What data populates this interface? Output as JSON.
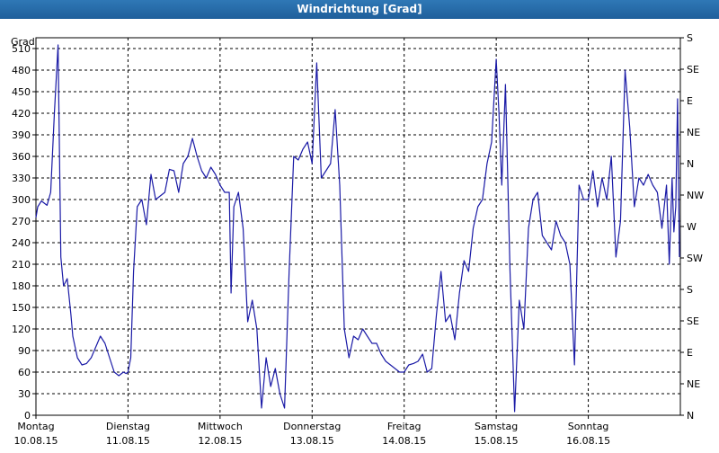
{
  "window": {
    "title": "Windrichtung [Grad]"
  },
  "chart_data": {
    "type": "line",
    "title": "Windrichtung [Grad]",
    "ylabel": "Grad",
    "ylim": [
      0,
      525
    ],
    "y_ticks": [
      0,
      30,
      60,
      90,
      120,
      150,
      180,
      210,
      240,
      270,
      300,
      330,
      360,
      390,
      420,
      450,
      480,
      510
    ],
    "y2_ticks": [
      {
        "value": 0,
        "label": "N"
      },
      {
        "value": 45,
        "label": "NE"
      },
      {
        "value": 90,
        "label": "E"
      },
      {
        "value": 135,
        "label": "SE"
      },
      {
        "value": 180,
        "label": "S"
      },
      {
        "value": 225,
        "label": "SW"
      },
      {
        "value": 270,
        "label": "W"
      },
      {
        "value": 315,
        "label": "NW"
      },
      {
        "value": 360,
        "label": "N"
      },
      {
        "value": 405,
        "label": "NE"
      },
      {
        "value": 450,
        "label": "E"
      },
      {
        "value": 495,
        "label": "SE"
      },
      {
        "value": 540,
        "label": "S"
      }
    ],
    "xlim": [
      0,
      7
    ],
    "x_days": [
      {
        "day": "Montag",
        "date": "10.08.15"
      },
      {
        "day": "Dienstag",
        "date": "11.08.15"
      },
      {
        "day": "Mittwoch",
        "date": "12.08.15"
      },
      {
        "day": "Donnerstag",
        "date": "13.08.15"
      },
      {
        "day": "Freitag",
        "date": "14.08.15"
      },
      {
        "day": "Samstag",
        "date": "15.08.15"
      },
      {
        "day": "Sonntag",
        "date": "16.08.15"
      }
    ],
    "grid": true,
    "series_color": "#1a1aa6",
    "series": [
      {
        "x": [
          0,
          0.02,
          0.06,
          0.12,
          0.16,
          0.2,
          0.24,
          0.27,
          0.3,
          0.34,
          0.38,
          0.4,
          0.45,
          0.5,
          0.55,
          0.6,
          0.65,
          0.7,
          0.75,
          0.8,
          0.85,
          0.9,
          0.95,
          0.98,
          1.0,
          1.03,
          1.06,
          1.1,
          1.15,
          1.2,
          1.25,
          1.3,
          1.35,
          1.4,
          1.45,
          1.5,
          1.55,
          1.6,
          1.65,
          1.7,
          1.75,
          1.8,
          1.85,
          1.9,
          1.95,
          2.0,
          2.05,
          2.1,
          2.12,
          2.15,
          2.2,
          2.25,
          2.3,
          2.35,
          2.4,
          2.45,
          2.5,
          2.55,
          2.6,
          2.65,
          2.7,
          2.75,
          2.8,
          2.85,
          2.9,
          2.95,
          3.0,
          3.05,
          3.1,
          3.15,
          3.2,
          3.25,
          3.3,
          3.35,
          3.4,
          3.45,
          3.5,
          3.55,
          3.6,
          3.65,
          3.7,
          3.75,
          3.8,
          3.85,
          3.9,
          3.95,
          4.0,
          4.05,
          4.1,
          4.15,
          4.2,
          4.25,
          4.3,
          4.35,
          4.4,
          4.45,
          4.5,
          4.55,
          4.6,
          4.65,
          4.7,
          4.75,
          4.8,
          4.85,
          4.9,
          4.95,
          5.0,
          5.03,
          5.06,
          5.1,
          5.15,
          5.2,
          5.25,
          5.3,
          5.35,
          5.4,
          5.45,
          5.5,
          5.55,
          5.6,
          5.65,
          5.7,
          5.75,
          5.8,
          5.85,
          5.9,
          5.95,
          6.0,
          6.05,
          6.1,
          6.15,
          6.2,
          6.25,
          6.3,
          6.35,
          6.4,
          6.45,
          6.5,
          6.55,
          6.6,
          6.65,
          6.7,
          6.75,
          6.8,
          6.85,
          6.88,
          6.91,
          6.93,
          6.95,
          6.97,
          6.99
        ],
        "y": [
          275,
          290,
          298,
          292,
          310,
          420,
          515,
          220,
          180,
          190,
          140,
          110,
          80,
          70,
          72,
          80,
          95,
          110,
          100,
          80,
          60,
          55,
          60,
          58,
          60,
          80,
          200,
          290,
          300,
          265,
          335,
          300,
          305,
          310,
          342,
          340,
          310,
          350,
          360,
          385,
          360,
          340,
          330,
          345,
          335,
          320,
          310,
          310,
          170,
          290,
          310,
          260,
          130,
          160,
          120,
          10,
          80,
          40,
          65,
          30,
          10,
          200,
          360,
          355,
          370,
          380,
          350,
          490,
          330,
          340,
          350,
          425,
          320,
          120,
          80,
          110,
          105,
          120,
          110,
          100,
          100,
          85,
          75,
          70,
          65,
          60,
          60,
          70,
          72,
          75,
          85,
          60,
          65,
          140,
          200,
          130,
          140,
          105,
          170,
          215,
          200,
          260,
          290,
          300,
          350,
          380,
          495,
          420,
          320,
          460,
          200,
          5,
          160,
          120,
          260,
          300,
          310,
          250,
          240,
          230,
          270,
          250,
          240,
          210,
          70,
          320,
          300,
          300,
          340,
          290,
          330,
          300,
          360,
          220,
          270,
          480,
          400,
          290,
          330,
          320,
          335,
          320,
          310,
          260,
          320,
          210,
          330,
          255,
          290,
          440,
          220
        ]
      }
    ]
  }
}
